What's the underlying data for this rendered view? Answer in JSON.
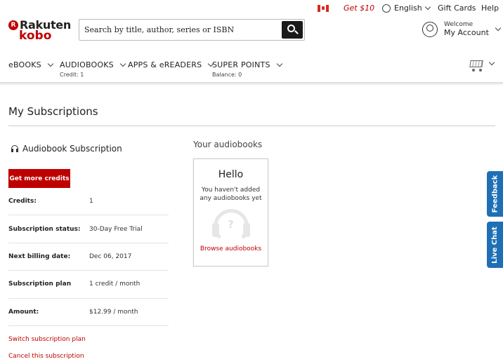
{
  "topbar": {
    "promo": "Get $10",
    "language": "English",
    "gift_cards": "Gift Cards",
    "help": "Help"
  },
  "logo": {
    "brand": "Rakuten",
    "mark": "R",
    "sub": "kobo"
  },
  "search": {
    "placeholder": "Search by title, author, series or ISBN"
  },
  "account": {
    "welcome": "Welcome",
    "label": "My Account"
  },
  "nav": {
    "items": [
      {
        "label": "eBOOKS",
        "sub": ""
      },
      {
        "label": "AUDIOBOOKS",
        "sub": "Credit: 1"
      },
      {
        "label": "APPS & eREADERS",
        "sub": ""
      },
      {
        "label": "SUPER POINTS",
        "sub": "Balance: 0"
      }
    ]
  },
  "page": {
    "title": "My Subscriptions",
    "subscription_heading": "Audiobook Subscription",
    "get_credits_button": "Get more credits",
    "details": [
      {
        "key": "Credits:",
        "value": "1"
      },
      {
        "key": "Subscription status:",
        "value": "30-Day Free Trial"
      },
      {
        "key": "Next billing date:",
        "value": "Dec 06, 2017"
      },
      {
        "key": "Subscription plan",
        "value": "1 credit / month"
      },
      {
        "key": "Amount:",
        "value": "$12.99 / month"
      }
    ],
    "switch_plan_link": "Switch subscription plan",
    "cancel_link": "Cancel this subscription"
  },
  "audiobooks": {
    "heading": "Your audiobooks",
    "card_title": "Hello",
    "card_message": "You haven't added any audiobooks yet",
    "placeholder_glyph": "?",
    "browse_link": "Browse audiobooks"
  },
  "side_tabs": {
    "feedback": "Feedback",
    "live_chat": "Live Chat"
  },
  "colors": {
    "brand_red": "#bf0000",
    "side_tab_blue": "#1f6fb5",
    "search_button": "#1a1a1a"
  },
  "icons": [
    "canada-flag-icon",
    "globe-icon",
    "search-icon",
    "user-icon",
    "cart-icon",
    "headphones-icon",
    "chevron-down-icon"
  ]
}
